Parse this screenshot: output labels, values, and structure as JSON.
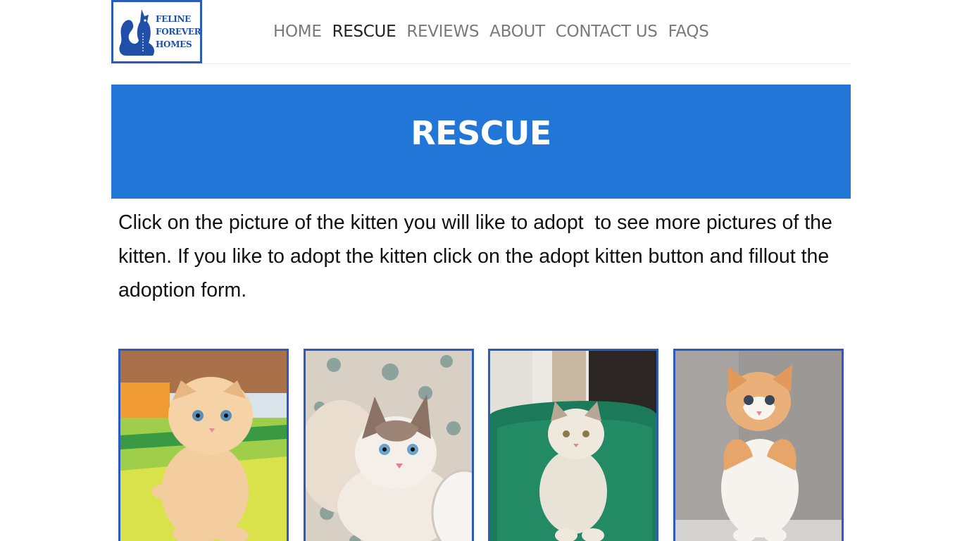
{
  "logo": {
    "lines": [
      "FELINE",
      "FOREVER",
      "HOMES"
    ]
  },
  "nav": {
    "items": [
      {
        "label": "HOME"
      },
      {
        "label": "RESCUE"
      },
      {
        "label": "REVIEWS"
      },
      {
        "label": "ABOUT"
      },
      {
        "label": "CONTACT US"
      },
      {
        "label": "FAQS"
      }
    ],
    "active": "RESCUE"
  },
  "banner": {
    "title": "RESCUE",
    "color": "#2276d8"
  },
  "intro": {
    "text": "Click on the picture of the kitten you will like to adopt  to see more pictures of the kitten. If you like to adopt the kitten click on the adopt kitten button and fillout the adoption form."
  },
  "gallery": {
    "kittens": [
      {
        "description_icon": "orange-scottish-fold-kitten"
      },
      {
        "description_icon": "ragdoll-kitten"
      },
      {
        "description_icon": "fluffy-cream-kitten"
      },
      {
        "description_icon": "ginger-white-kitten"
      }
    ]
  }
}
